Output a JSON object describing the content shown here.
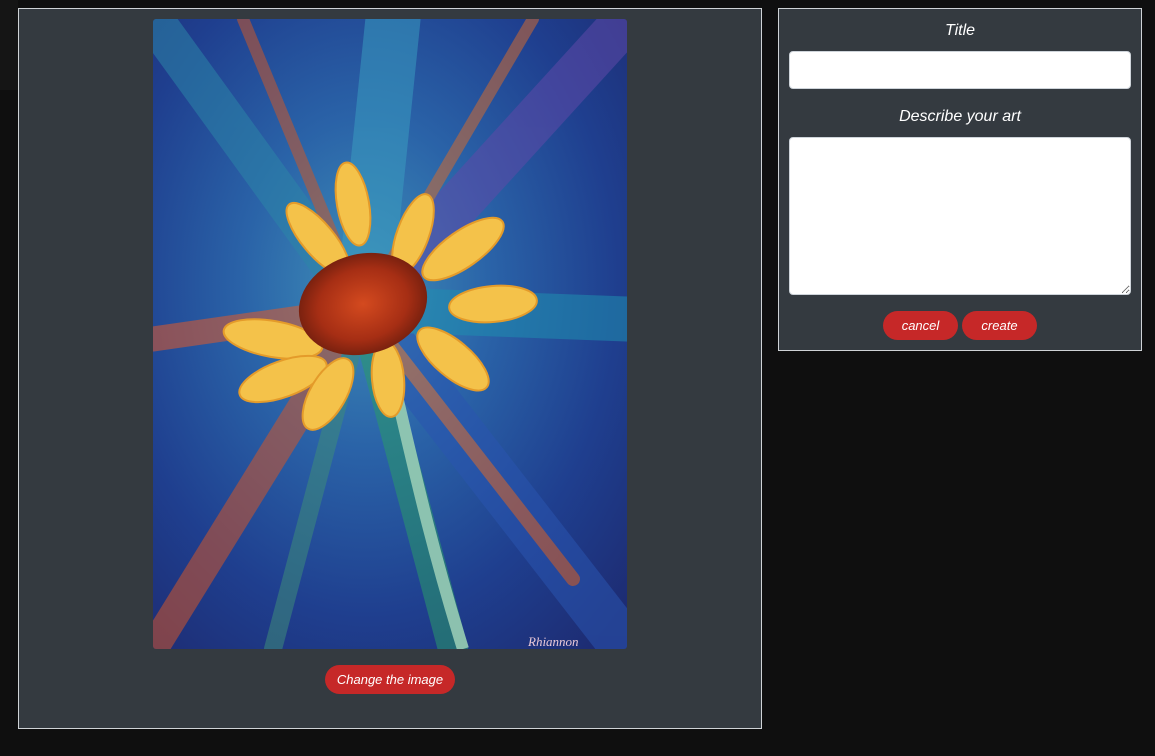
{
  "artwork": {
    "signature": "Rhiannon",
    "alt": "Sunflower painting"
  },
  "image_panel": {
    "change_image_label": "Change the image"
  },
  "form": {
    "title_label": "Title",
    "title_value": "",
    "description_label": "Describe your art",
    "description_value": "",
    "cancel_label": "cancel",
    "create_label": "create"
  },
  "colors": {
    "page_background": "#0f0f0f",
    "panel_background": "#343a40",
    "accent_red": "#c62828"
  }
}
